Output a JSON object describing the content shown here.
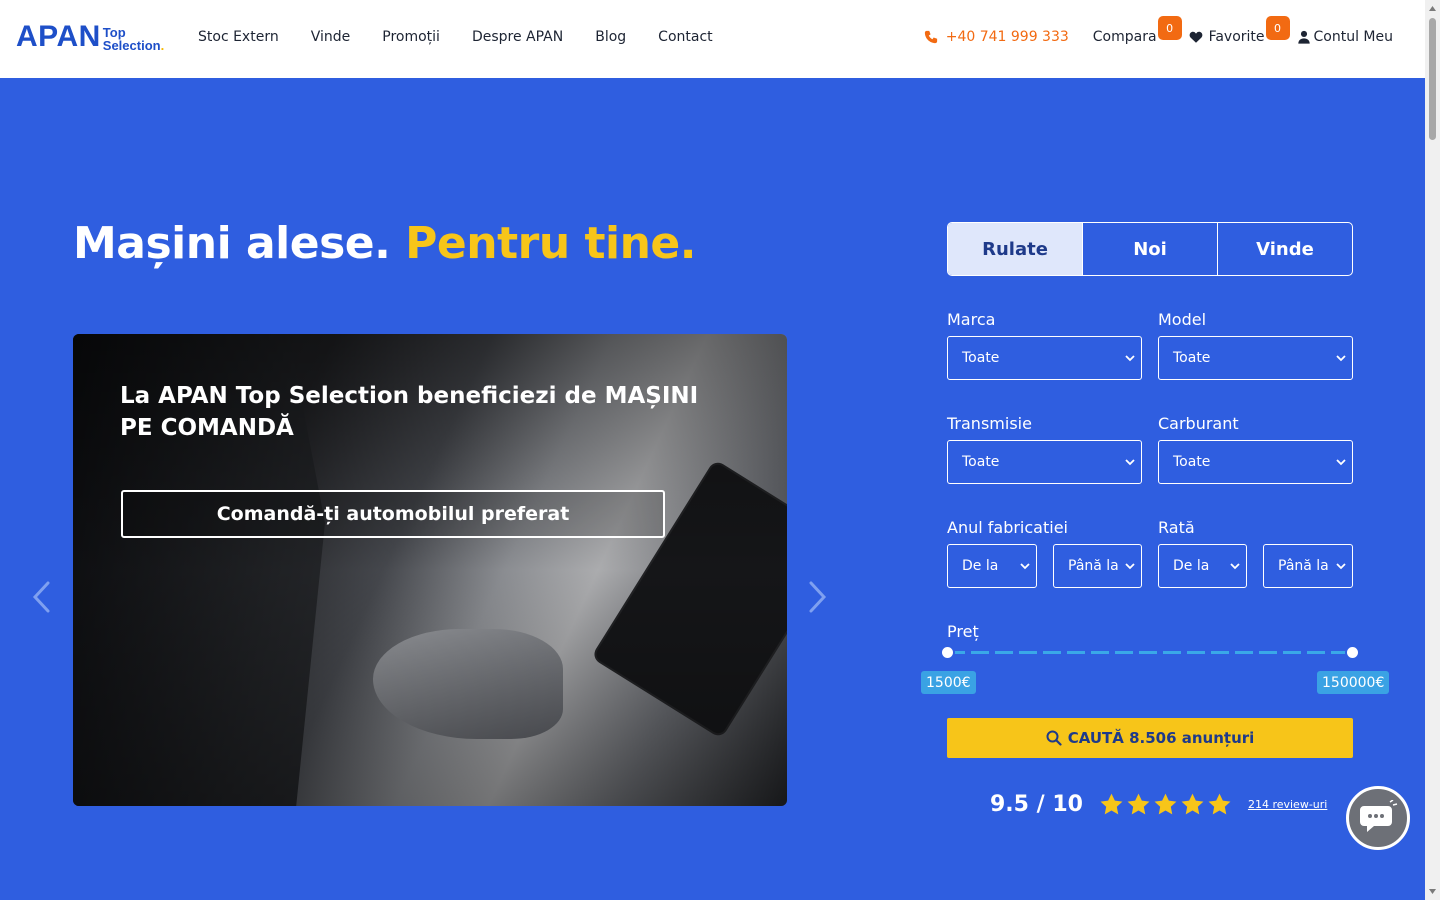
{
  "header": {
    "logo_main": "APAN",
    "logo_sub_1": "Top",
    "logo_sub_2": "Selection",
    "logo_dot": ".",
    "nav": [
      "Stoc Extern",
      "Vinde",
      "Promoții",
      "Despre APAN",
      "Blog",
      "Contact"
    ],
    "phone": "+40 741 999 333",
    "compare_label": "Compara",
    "compare_count": "0",
    "favorites_label": "Favorite",
    "favorites_count": "0",
    "account_label": "Contul Meu"
  },
  "hero": {
    "title_main": "Mașini alese.",
    "title_accent": "Pentru tine."
  },
  "slide": {
    "text": "La APAN Top Selection beneficiezi de MAȘINI PE COMANDĂ",
    "button": "Comandă-ți automobilul preferat"
  },
  "search": {
    "tabs": [
      "Rulate",
      "Noi",
      "Vinde"
    ],
    "active_tab": "Rulate",
    "marca_label": "Marca",
    "marca_value": "Toate",
    "model_label": "Model",
    "model_value": "Toate",
    "transmisie_label": "Transmisie",
    "transmisie_value": "Toate",
    "carburant_label": "Carburant",
    "carburant_value": "Toate",
    "an_label": "Anul fabricatiei",
    "an_from": "De la",
    "an_to": "Până la",
    "rata_label": "Rată",
    "rata_from": "De la",
    "rata_to": "Până la",
    "price_label": "Preț",
    "price_min": "1500€",
    "price_max": "150000€",
    "button": "CAUTĂ 8.506 anunțuri"
  },
  "rating": {
    "score": "9.5 / 10",
    "stars": 5,
    "reviews": "214 review-uri"
  },
  "colors": {
    "background": "#2f5ee0",
    "accent": "#f7c519",
    "badge": "#f26a12",
    "brand": "#1e4fc8"
  }
}
